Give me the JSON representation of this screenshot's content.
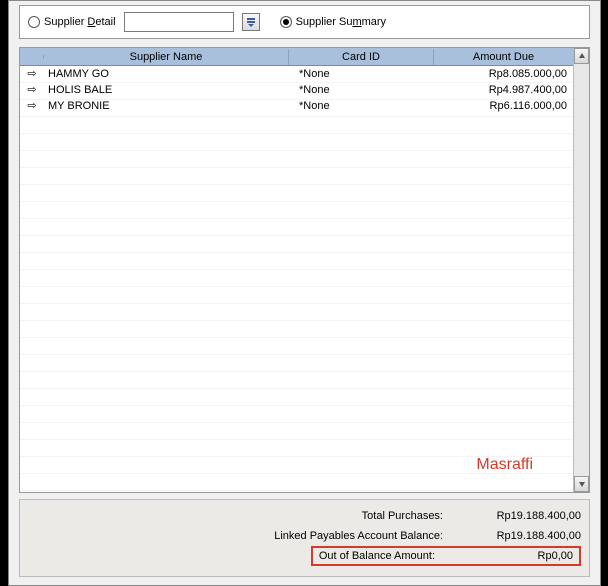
{
  "filter": {
    "detail_label_pre": "Supplier ",
    "detail_access": "D",
    "detail_label_post": "etail",
    "summary_label_pre": "Supplier Su",
    "summary_access": "m",
    "summary_label_post": "mary",
    "selected": "summary",
    "combo_value": ""
  },
  "columns": {
    "name": "Supplier Name",
    "card": "Card ID",
    "amount": "Amount Due"
  },
  "rows": [
    {
      "name": "HAMMY GO",
      "card_id": "*None",
      "amount_due": "Rp8.085.000,00"
    },
    {
      "name": "HOLIS BALE",
      "card_id": "*None",
      "amount_due": "Rp4.987.400,00"
    },
    {
      "name": "MY BRONIE",
      "card_id": "*None",
      "amount_due": "Rp6.116.000,00"
    }
  ],
  "totals": {
    "total_purchases_label": "Total Purchases:",
    "total_purchases_value": "Rp19.188.400,00",
    "linked_balance_label": "Linked Payables Account Balance:",
    "linked_balance_value": "Rp19.188.400,00",
    "out_of_balance_label": "Out of Balance Amount:",
    "out_of_balance_value": "Rp0,00"
  },
  "watermark": "Masraffi"
}
